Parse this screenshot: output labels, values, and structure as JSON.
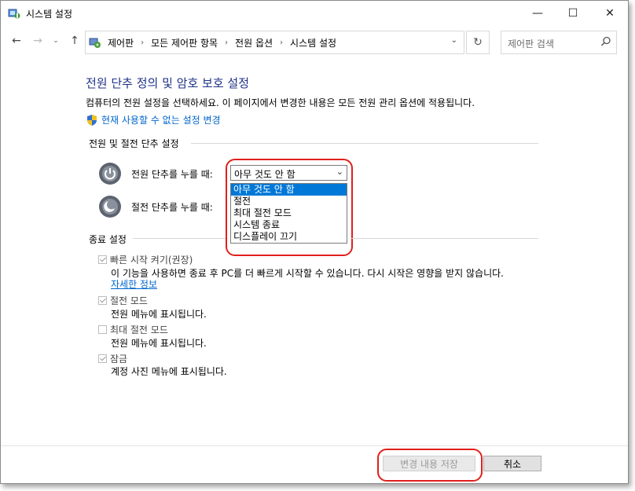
{
  "window": {
    "title": "시스템 설정",
    "min_glyph": "—",
    "max_glyph": "☐",
    "close_glyph": "✕"
  },
  "nav": {
    "back_glyph": "←",
    "forward_glyph": "→",
    "recent_glyph": "⌄",
    "up_glyph": "↑",
    "breadcrumbs": [
      "제어판",
      "모든 제어판 항목",
      "전원 옵션",
      "시스템 설정"
    ],
    "separator": "›",
    "dropdown_glyph": "⌄",
    "refresh_glyph": "↻",
    "search_placeholder": "제어판 검색"
  },
  "page": {
    "title": "전원 단추 정의 및 암호 보호 설정",
    "description": "컴퓨터의 전원 설정을 선택하세요. 이 페이지에서 변경한 내용은 모든 전원 관리 옵션에 적용됩니다.",
    "change_link": "현재 사용할 수 없는 설정 변경"
  },
  "power_section": {
    "heading": "전원 및 절전 단추 설정",
    "power_button_label": "전원 단추를 누를 때:",
    "sleep_button_label": "절전 단추를 누를 때:",
    "selected": "아무 것도 안 함",
    "options": [
      "아무 것도 안 함",
      "절전",
      "최대 절전 모드",
      "시스템 종료",
      "디스플레이 끄기"
    ],
    "selected_index": 0
  },
  "shutdown_section": {
    "heading": "종료 설정",
    "items": [
      {
        "label": "빠른 시작 켜기(권장)",
        "checked": true,
        "desc": "이 기능을 사용하면 종료 후 PC를 더 빠르게 시작할 수 있습니다. 다시 시작은 영향을 받지 않습니다.",
        "link": "자세한 정보"
      },
      {
        "label": "절전 모드",
        "checked": true,
        "desc": "전원 메뉴에 표시됩니다."
      },
      {
        "label": "최대 절전 모드",
        "checked": false,
        "desc": "전원 메뉴에 표시됩니다."
      },
      {
        "label": "잠금",
        "checked": true,
        "desc": "계정 사진 메뉴에 표시됩니다."
      }
    ]
  },
  "footer": {
    "save_label": "변경 내용 저장",
    "cancel_label": "취소"
  },
  "colors": {
    "title_blue": "#1e3287",
    "link_blue": "#0066cc",
    "selection_blue": "#0078d7",
    "highlight_red": "#e0201c"
  }
}
